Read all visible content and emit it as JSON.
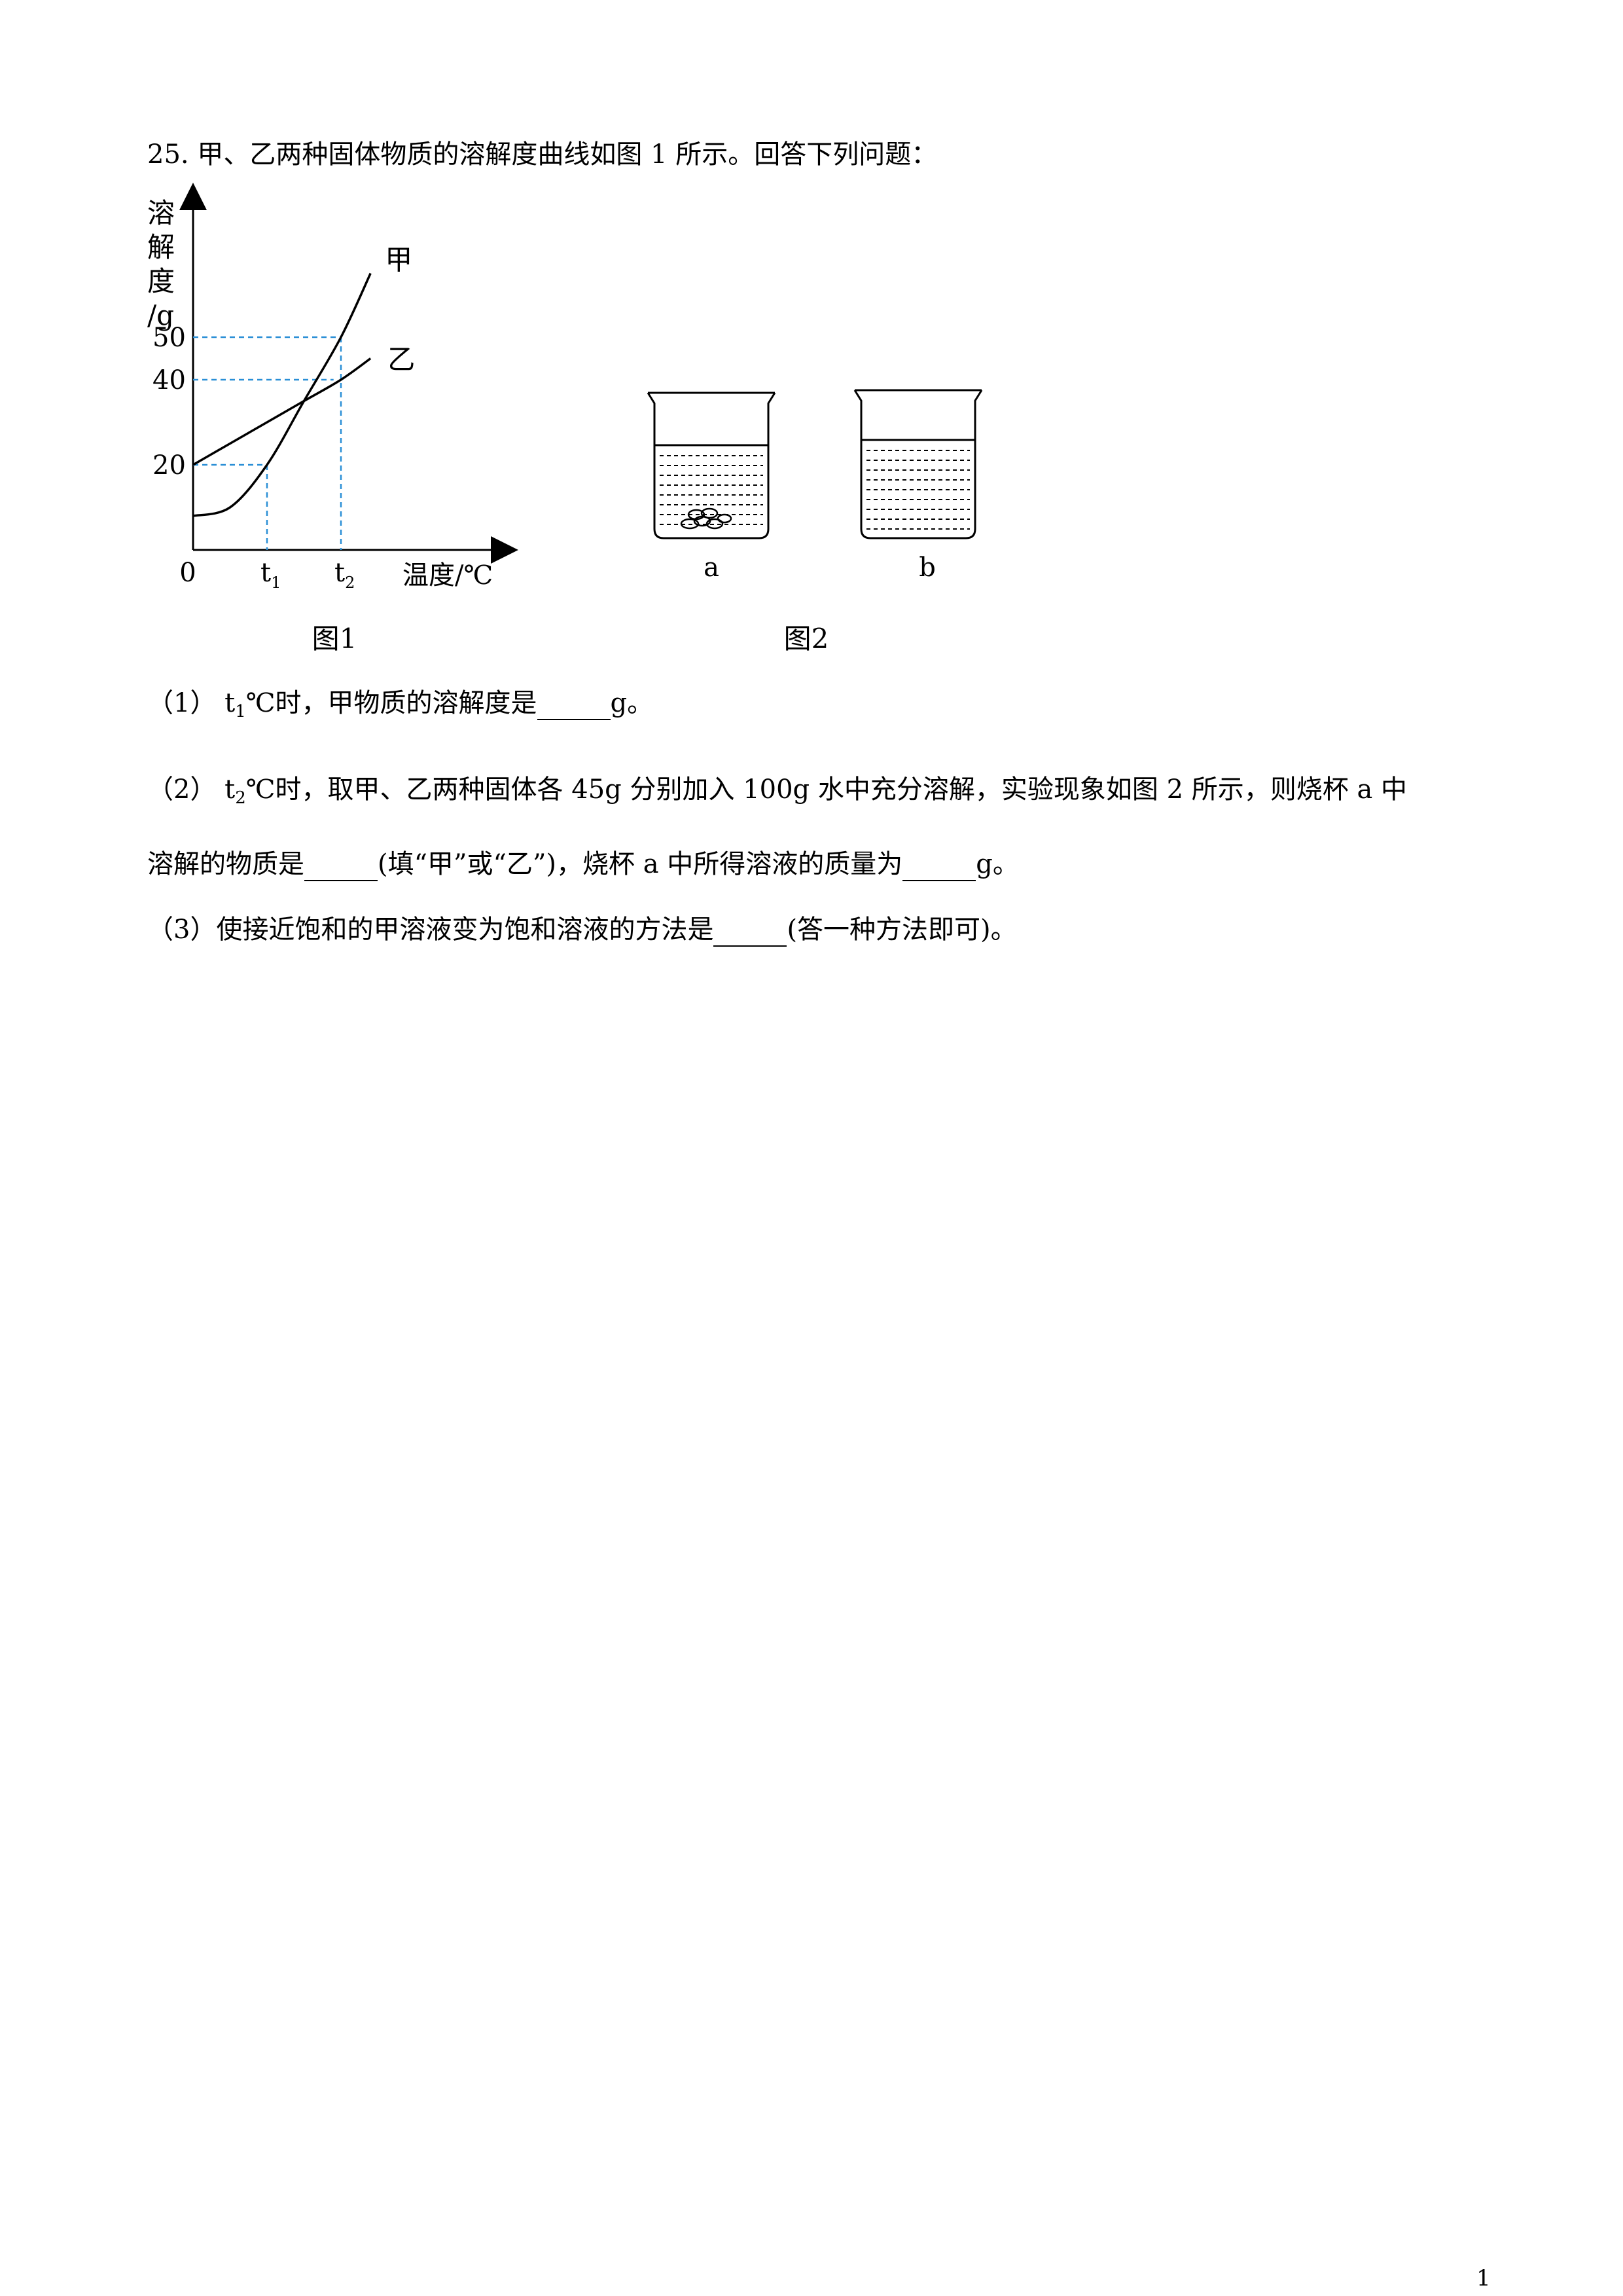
{
  "question": {
    "title": "25. 甲、乙两种固体物质的溶解度曲线如图 1 所示。回答下列问题：",
    "q1": {
      "pre": "（1） t",
      "sub": "1",
      "post": "℃时，甲物质的溶解度是",
      "unit": "g。"
    },
    "q2": {
      "pre": "（2） t",
      "sub": "2",
      "post": "℃时，取甲、乙两种固体各 45g 分别加入 100g 水中充分溶解，实验现象如图 2 所示，则烧杯 a 中",
      "line2_pre": "溶解的物质是",
      "line2_mid": "(填“甲”或“乙”)，烧杯 a 中所得溶液的质量为",
      "line2_unit": "g。"
    },
    "q3": {
      "pre": "（3）使接近饱和的甲溶液变为饱和溶液的方法是",
      "post": "(答一种方法即可)。"
    }
  },
  "chart_data": {
    "type": "line",
    "ylabel": "溶解度/g",
    "ylabel_chars": [
      "溶",
      "解",
      "度",
      "/g"
    ],
    "xlabel": "温度/℃",
    "origin_label": "0",
    "ytick_labels": [
      {
        "label": "50",
        "value": 50
      },
      {
        "label": "40",
        "value": 40
      },
      {
        "label": "20",
        "value": 20
      }
    ],
    "xtick_labels": [
      {
        "label": "t",
        "sub": "1",
        "value": 1
      },
      {
        "label": "t",
        "sub": "2",
        "value": 2
      }
    ],
    "xlim": [
      0,
      4.2
    ],
    "ylim": [
      0,
      78
    ],
    "series": [
      {
        "name": "甲",
        "points": [
          [
            0,
            8
          ],
          [
            0.5,
            10
          ],
          [
            1,
            20
          ],
          [
            1.5,
            35
          ],
          [
            2,
            50
          ],
          [
            2.4,
            65
          ]
        ],
        "color": "#000000"
      },
      {
        "name": "乙",
        "points": [
          [
            0,
            20
          ],
          [
            0.5,
            25
          ],
          [
            1,
            30
          ],
          [
            1.5,
            35
          ],
          [
            2,
            40
          ],
          [
            2.4,
            45
          ]
        ],
        "color": "#000000"
      }
    ],
    "guide_color": "#2a8fd6",
    "caption": "图1"
  },
  "figure2": {
    "beaker_a_label": "a",
    "beaker_b_label": "b",
    "caption": "图2"
  },
  "page_number": "1"
}
